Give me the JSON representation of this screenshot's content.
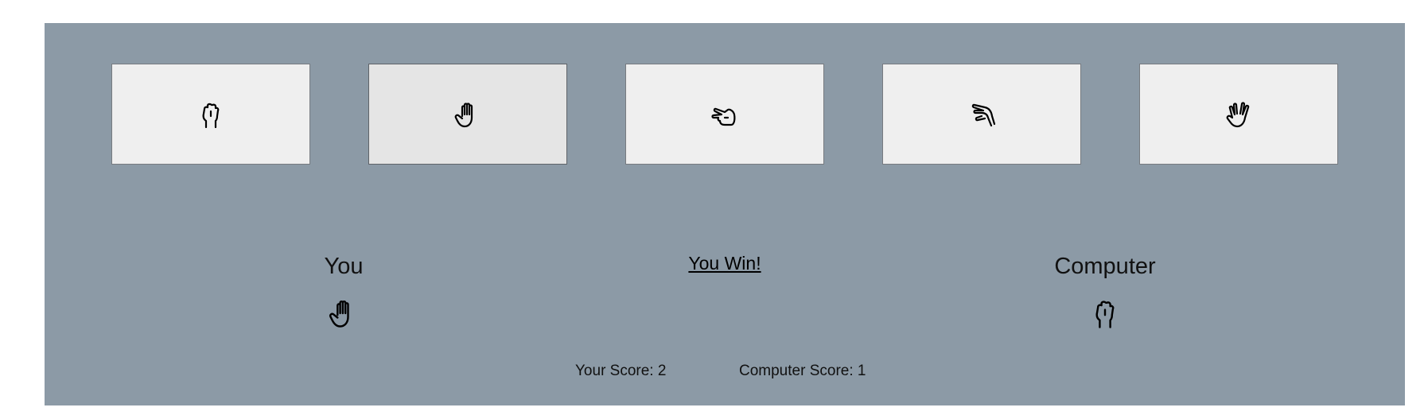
{
  "choices": [
    {
      "name": "rock",
      "icon": "rock-hand-icon",
      "active": false
    },
    {
      "name": "paper",
      "icon": "paper-hand-icon",
      "active": true
    },
    {
      "name": "scissors",
      "icon": "scissors-hand-icon",
      "active": false
    },
    {
      "name": "lizard",
      "icon": "lizard-hand-icon",
      "active": false
    },
    {
      "name": "spock",
      "icon": "spock-hand-icon",
      "active": false
    }
  ],
  "players": {
    "you": {
      "label": "You",
      "pick_icon": "paper-hand-icon"
    },
    "computer": {
      "label": "Computer",
      "pick_icon": "rock-hand-icon"
    }
  },
  "result": {
    "text": "You Win!"
  },
  "scores": {
    "you": "Your Score: 2",
    "computer": "Computer Score: 1"
  },
  "colors": {
    "panel_bg": "#8c9aa6",
    "button_bg": "#efefef",
    "button_active_bg": "#e5e5e5"
  }
}
